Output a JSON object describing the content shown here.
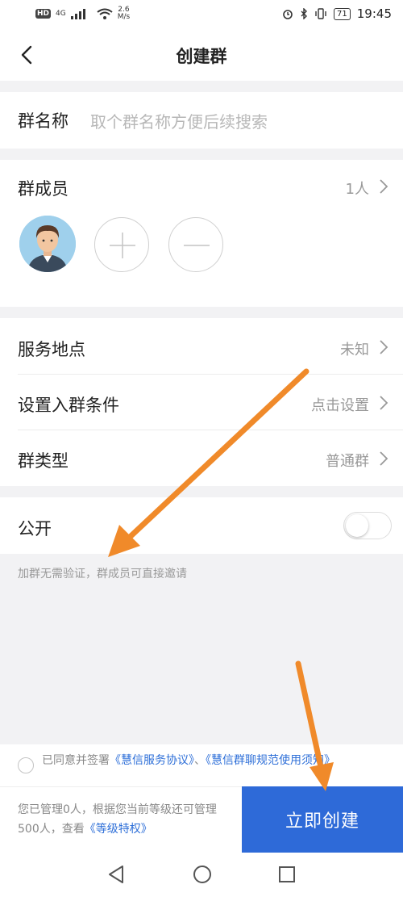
{
  "status_bar": {
    "hd": "HD",
    "network": "4G",
    "speed_value": "2.6",
    "speed_unit": "M/s",
    "battery": "71",
    "time": "19:45"
  },
  "header": {
    "title": "创建群"
  },
  "group_name": {
    "label": "群名称",
    "placeholder": "取个群名称方便后续搜索"
  },
  "members": {
    "label": "群成员",
    "count": "1人"
  },
  "settings": {
    "location_label": "服务地点",
    "location_value": "未知",
    "condition_label": "设置入群条件",
    "condition_value": "点击设置",
    "type_label": "群类型",
    "type_value": "普通群"
  },
  "public": {
    "label": "公开",
    "enabled": false,
    "hint": "加群无需验证，群成员可直接邀请"
  },
  "agreement": {
    "prefix": "已同意并签署",
    "link1": "《慧信服务协议》",
    "separator": "、",
    "link2": "《慧信群聊规范使用须知》"
  },
  "footer": {
    "info_text": "您已管理0人，根据您当前等级还可管理500人，查看",
    "info_link": "《等级特权》",
    "create_button": "立即创建"
  },
  "colors": {
    "accent": "#2e6ad8",
    "annotation_arrow": "#f08a2a"
  }
}
